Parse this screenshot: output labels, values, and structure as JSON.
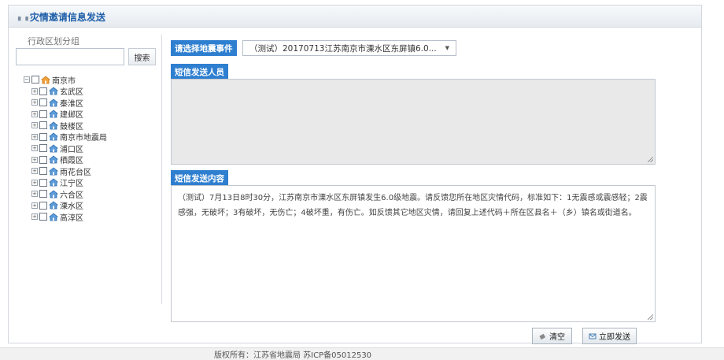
{
  "page": {
    "title": "灾情邀请信息发送",
    "title_icon": "bar-chart-icon"
  },
  "left_panel": {
    "region_label": "行政区划分组",
    "search_input_value": "",
    "search_button": "搜索",
    "tree": {
      "root": {
        "label": "南京市",
        "expander": "⊟"
      },
      "children": [
        {
          "label": "玄武区"
        },
        {
          "label": "秦淮区"
        },
        {
          "label": "建邺区"
        },
        {
          "label": "鼓楼区"
        },
        {
          "label": "南京市地震局"
        },
        {
          "label": "浦口区"
        },
        {
          "label": "栖霞区"
        },
        {
          "label": "雨花台区"
        },
        {
          "label": "江宁区"
        },
        {
          "label": "六合区"
        },
        {
          "label": "溧水区"
        },
        {
          "label": "高淳区"
        }
      ],
      "child_expander": "⊞"
    }
  },
  "right_panel": {
    "event_label": "请选择地震事件",
    "event_selected": "（测试）20170713江苏南京市溧水区东屏镇6.0...",
    "recipients_label": "短信发送人员",
    "recipients_value": "",
    "content_label": "短信发送内容",
    "content_value": "（测试）7月13日8时30分，江苏南京市溧水区东屏镇发生6.0级地震。请反馈您所在地区灾情代码，标准如下：1无震感或震感轻；2震感强，无破坏；3有破坏，无伤亡；4破坏重，有伤亡。如反馈其它地区灾情，请回复上述代码＋所在区县名＋（乡）镇名或街道名。"
  },
  "actions": {
    "clear_label": "清空",
    "send_label": "立即发送"
  },
  "footer": {
    "text": "版权所有：江苏省地震局  苏ICP备05012530"
  },
  "colors": {
    "accent": "#2f7fd0",
    "title": "#1f5fa8"
  }
}
